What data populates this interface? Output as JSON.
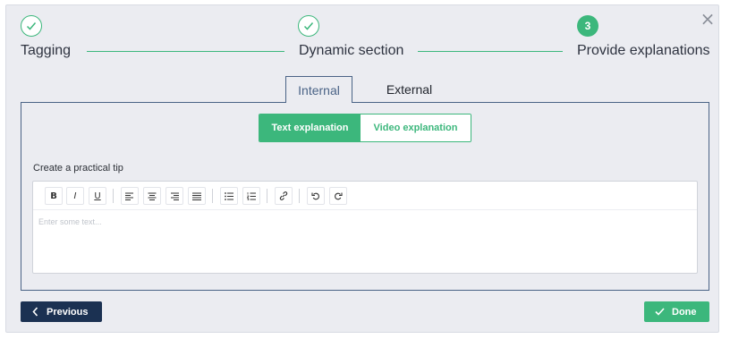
{
  "stepper": {
    "steps": [
      {
        "label": "Tagging",
        "state": "complete",
        "icon": "check-icon"
      },
      {
        "label": "Dynamic section",
        "state": "complete",
        "icon": "check-icon"
      },
      {
        "label": "Provide explanations",
        "state": "current",
        "number": "3"
      }
    ]
  },
  "close_icon": "×",
  "tabs": [
    {
      "label": "Internal",
      "active": true
    },
    {
      "label": "External",
      "active": false
    }
  ],
  "explanation_type": {
    "options": [
      {
        "label": "Text explanation",
        "active": true
      },
      {
        "label": "Video explanation",
        "active": false
      }
    ]
  },
  "tip": {
    "label": "Create a practical tip",
    "placeholder": "Enter some text..."
  },
  "toolbar": {
    "buttons": [
      "bold-icon",
      "italic-icon",
      "underline-icon",
      "align-left-icon",
      "align-center-icon",
      "align-right-icon",
      "align-justify-icon",
      "bullet-list-icon",
      "numbered-list-icon",
      "link-icon",
      "undo-icon",
      "redo-icon"
    ],
    "bold": "B",
    "italic": "I",
    "underline": "U"
  },
  "footer": {
    "previous_label": "Previous",
    "done_label": "Done"
  },
  "colors": {
    "accent_green": "#3cb77c",
    "navy": "#1b3152",
    "tab_border": "#4a6386",
    "background": "#ebecf1"
  }
}
